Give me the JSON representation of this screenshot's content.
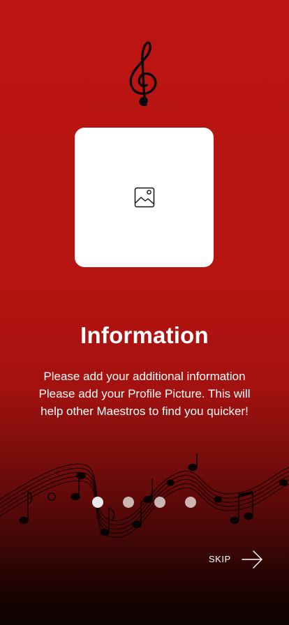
{
  "header": {
    "logo_icon": "treble-clef-icon"
  },
  "photo": {
    "icon": "image-placeholder-icon"
  },
  "content": {
    "title": "Information",
    "lines": [
      "Please add your additional information",
      "Please add your Profile Picture. This will",
      "help other Maestros to find you quicker!"
    ]
  },
  "pagination": {
    "total": 4,
    "active_index": 0
  },
  "footer": {
    "skip_label": "SKIP",
    "next_icon": "arrow-right-icon"
  },
  "colors": {
    "background_top": "#bb1512",
    "background_bottom": "#0d0202",
    "card": "#ffffff"
  }
}
